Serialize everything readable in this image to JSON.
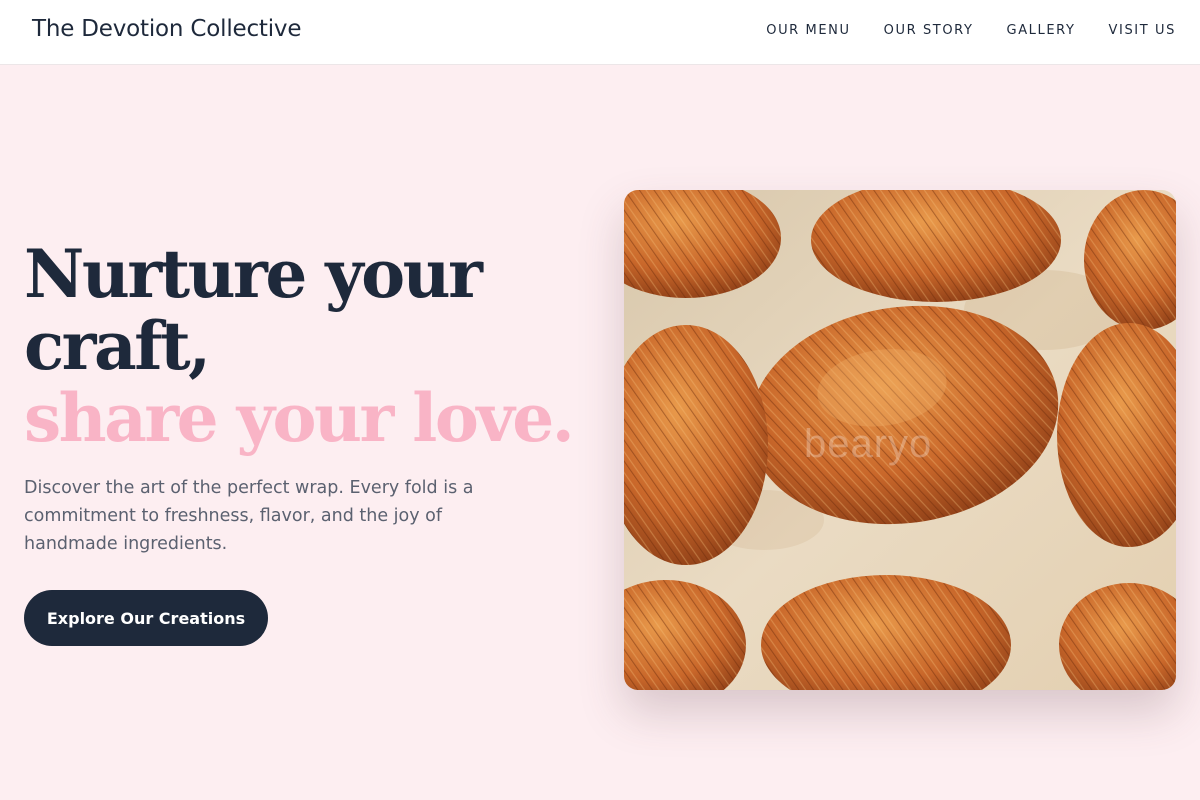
{
  "header": {
    "brand": "The Devotion Collective",
    "nav": [
      {
        "label": "OUR MENU"
      },
      {
        "label": "OUR STORY"
      },
      {
        "label": "GALLERY"
      },
      {
        "label": "VISIT US"
      }
    ]
  },
  "hero": {
    "headline_line1": "Nurture your",
    "headline_line2": "craft,",
    "headline_accent": "share your love.",
    "description": "Discover the art of the perfect wrap. Every fold is a commitment to freshness, flavor, and the joy of handmade ingredients.",
    "cta_label": "Explore Our Creations",
    "image_watermark": "bearyo"
  },
  "colors": {
    "navy": "#1e293b",
    "accent_pink": "#f9b4c6",
    "hero_background": "#fdeef1",
    "body_text": "#5b6170"
  }
}
